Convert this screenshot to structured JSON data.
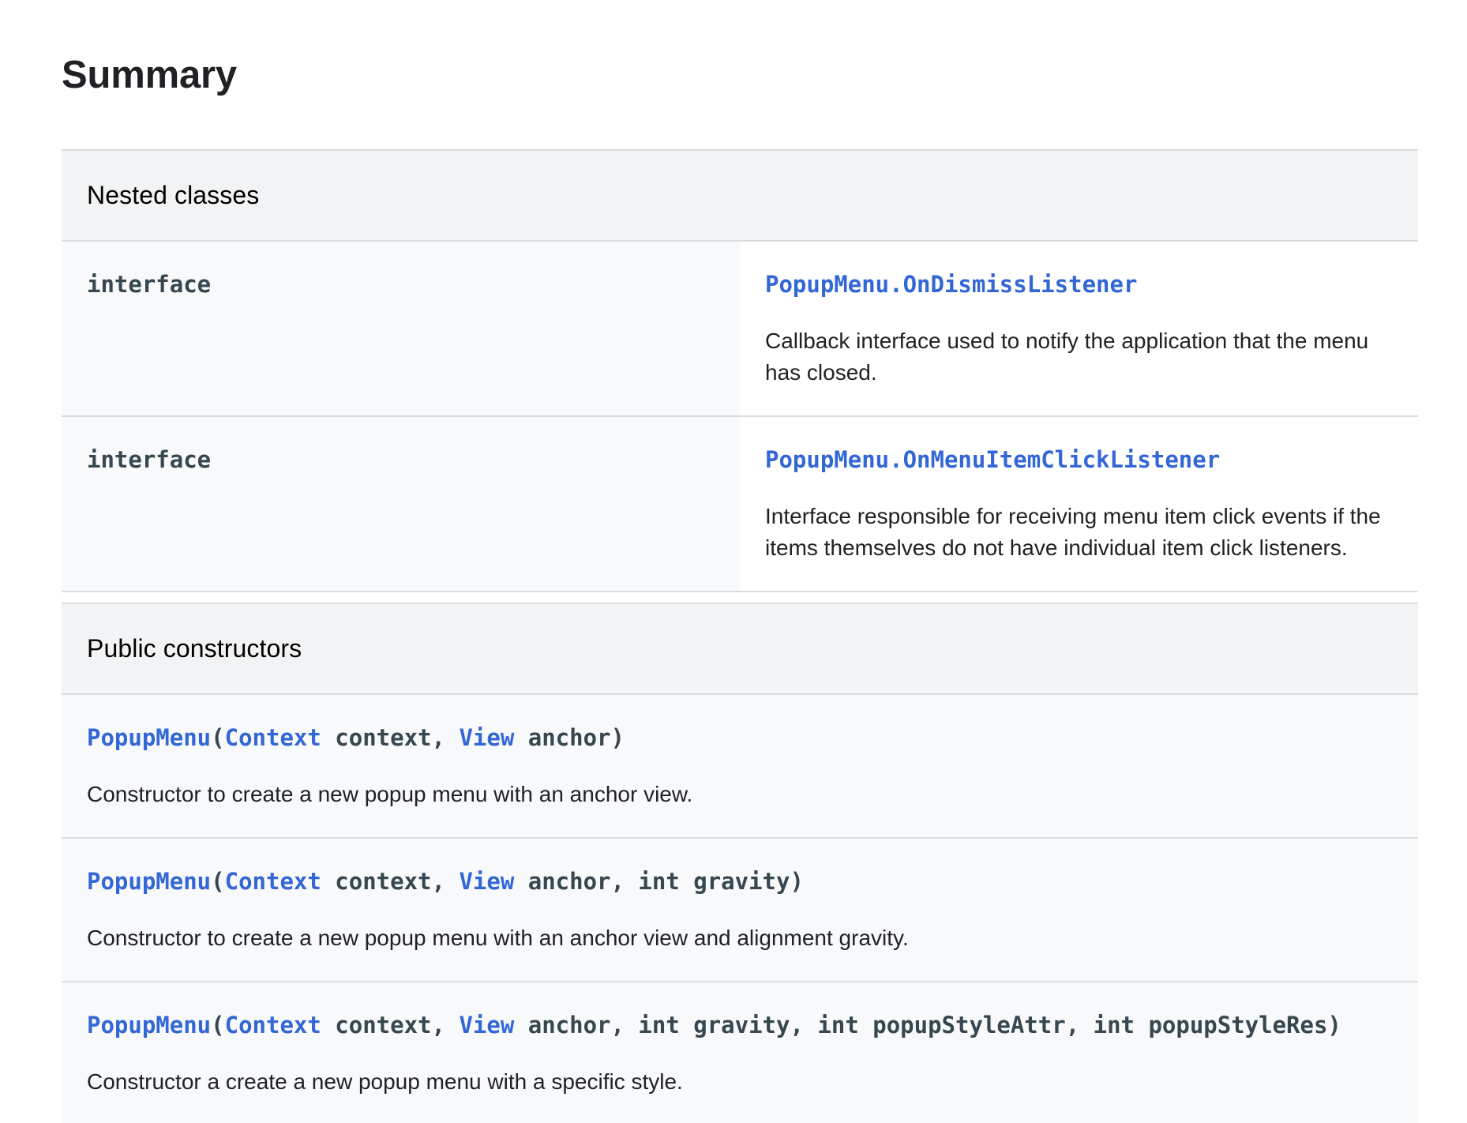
{
  "summary": {
    "title": "Summary"
  },
  "nested_classes": {
    "header": "Nested classes",
    "rows": [
      {
        "type": "interface",
        "name": "PopupMenu.OnDismissListener",
        "description": "Callback interface used to notify the application that the menu has closed."
      },
      {
        "type": "interface",
        "name": "PopupMenu.OnMenuItemClickListener",
        "description": "Interface responsible for receiving menu item click events if the items themselves do not have individual item click listeners."
      }
    ]
  },
  "public_constructors": {
    "header": "Public constructors",
    "rows": [
      {
        "name": "PopupMenu",
        "open_paren": "(",
        "params": [
          {
            "type": "Context",
            "name": " context",
            "sep": ", "
          },
          {
            "type": "View",
            "name": " anchor",
            "sep": ""
          }
        ],
        "close_paren": ")",
        "description": "Constructor to create a new popup menu with an anchor view."
      },
      {
        "name": "PopupMenu",
        "open_paren": "(",
        "params": [
          {
            "type": "Context",
            "name": " context",
            "sep": ", "
          },
          {
            "type": "View",
            "name": " anchor",
            "sep": ", "
          },
          {
            "plain": "int gravity",
            "sep": ""
          }
        ],
        "close_paren": ")",
        "description": "Constructor to create a new popup menu with an anchor view and alignment gravity."
      },
      {
        "name": "PopupMenu",
        "open_paren": "(",
        "params": [
          {
            "type": "Context",
            "name": " context",
            "sep": ", "
          },
          {
            "type": "View",
            "name": " anchor",
            "sep": ", "
          },
          {
            "plain": "int gravity",
            "sep": ", "
          },
          {
            "plain": "int popupStyleAttr",
            "sep": ", "
          },
          {
            "plain": "int popupStyleRes",
            "sep": ""
          }
        ],
        "close_paren": ")",
        "description": "Constructor a create a new popup menu with a specific style."
      }
    ]
  },
  "colors": {
    "link": "#3367d6",
    "code": "#37474f",
    "header_bg": "#f1f3f4",
    "row_bg": "#f8f9fa",
    "border": "#dadce0"
  }
}
